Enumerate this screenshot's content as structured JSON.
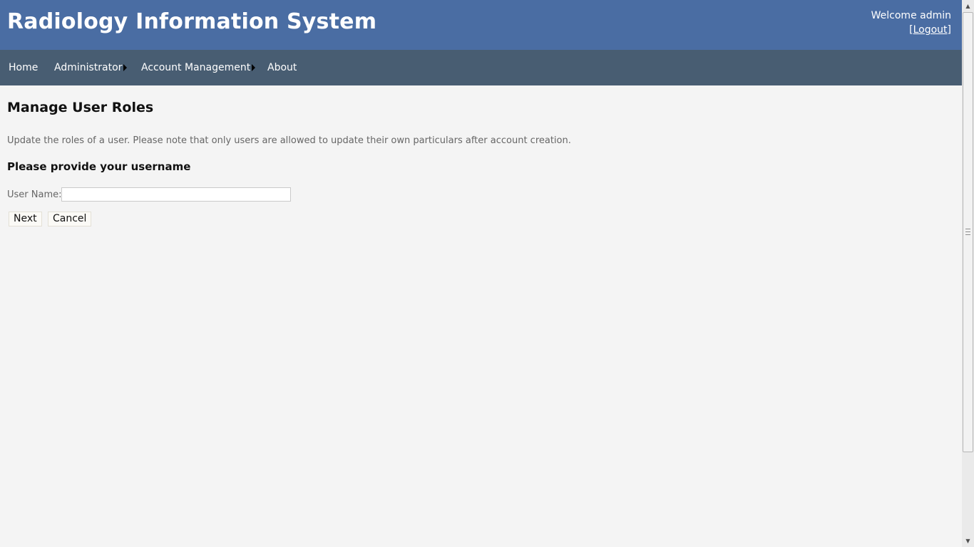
{
  "header": {
    "app_title": "Radiology Information System",
    "welcome_text": "Welcome admin",
    "logout_open": "[",
    "logout_label": "Logout",
    "logout_close": "]"
  },
  "nav": {
    "home": "Home",
    "administrator": "Administrator",
    "account_management": "Account Management",
    "about": "About"
  },
  "main": {
    "page_title": "Manage User Roles",
    "description": "Update the roles of a user. Please note that only users are allowed to update their own particulars after account creation.",
    "section_heading": "Please provide your username",
    "username_label": "User Name:",
    "username_value": "",
    "next_label": "Next",
    "cancel_label": "Cancel"
  },
  "colors": {
    "header_bg": "#4a6da3",
    "nav_bg": "#485d72",
    "page_bg": "#f4f4f4"
  },
  "icons": {
    "nav_submenu": "arrow-right-icon",
    "scroll_up": "chevron-up-icon",
    "scroll_down": "chevron-down-icon"
  }
}
